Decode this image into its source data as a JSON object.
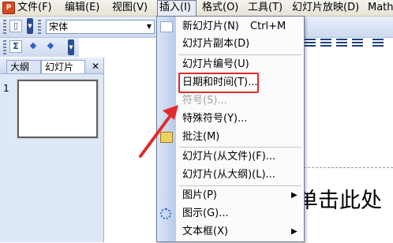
{
  "menubar": {
    "items": [
      {
        "label": "文件(F)"
      },
      {
        "label": "编辑(E)"
      },
      {
        "label": "视图(V)"
      },
      {
        "label": "插入(I)"
      },
      {
        "label": "格式(O)"
      },
      {
        "label": "工具(T)"
      },
      {
        "label": "幻灯片放映(D)"
      },
      {
        "label": "Math"
      }
    ]
  },
  "toolbar": {
    "font_value": "宋体"
  },
  "left_pane": {
    "tabs": [
      {
        "label": "大纲"
      },
      {
        "label": "幻灯片"
      }
    ],
    "close_label": "✕",
    "slide_number": "1"
  },
  "insert_menu": {
    "items": [
      {
        "label": "新幻灯片(N)",
        "shortcut": "Ctrl+M"
      },
      {
        "label": "幻灯片副本(D)"
      },
      {
        "label": "幻灯片编号(U)"
      },
      {
        "label": "日期和时间(T)..."
      },
      {
        "label": "符号(S)...",
        "disabled": true
      },
      {
        "label": "特殊符号(Y)..."
      },
      {
        "label": "批注(M)"
      },
      {
        "label": "幻灯片(从文件)(F)..."
      },
      {
        "label": "幻灯片(从大纲)(L)..."
      },
      {
        "label": "图片(P)",
        "submenu": true
      },
      {
        "label": "图示(G)..."
      },
      {
        "label": "文本框(X)",
        "submenu": true
      }
    ]
  },
  "slide": {
    "placeholder_text": "单击此处"
  },
  "colors": {
    "highlight": "#e02b2b",
    "menubar": "#e6e3d6",
    "toolbar": "#cfdaf0"
  },
  "icons": [
    "app-icon",
    "new-doc-icon",
    "sigma-icon",
    "back-arrow-icon",
    "forward-arrow-icon",
    "new-slide-icon",
    "comment-icon",
    "diagram-icon"
  ]
}
